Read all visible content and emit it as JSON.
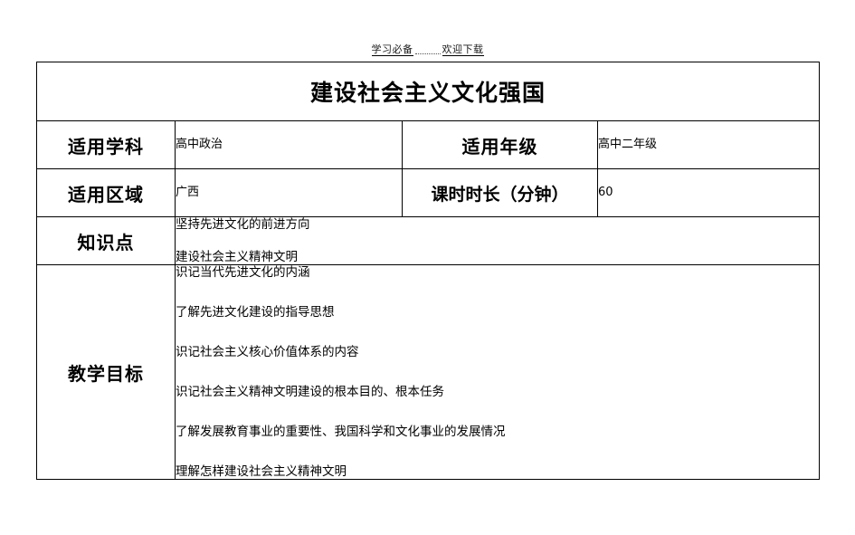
{
  "header": {
    "note_left": "学习必备",
    "note_right": "欢迎下载"
  },
  "document": {
    "title": "建设社会主义文化强国",
    "rows": [
      {
        "label_a": "适用学科",
        "value_a": "高中政治",
        "label_b": "适用年级",
        "value_b": "高中二年级"
      },
      {
        "label_a": "适用区域",
        "value_a": "广西",
        "label_b": "课时时长（分钟）",
        "value_b": "60"
      }
    ],
    "knowledge": {
      "label": "知识点",
      "items": [
        "坚持先进文化的前进方向",
        "建设社会主义精神文明"
      ]
    },
    "objectives": {
      "label": "教学目标",
      "items": [
        "识记当代先进文化的内涵",
        "了解先进文化建设的指导思想",
        "识记社会主义核心价值体系的内容",
        "识记社会主义精神文明建设的根本目的、根本任务",
        "了解发展教育事业的重要性、我国科学和文化事业的发展情况",
        "理解怎样建设社会主义精神文明"
      ]
    }
  }
}
